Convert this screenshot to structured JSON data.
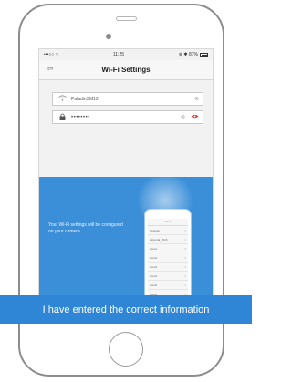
{
  "status_bar": {
    "signal": "•••○○",
    "wifi": "≈",
    "time": "11:25",
    "right": "⊕ ✱ 87%"
  },
  "nav": {
    "back_icon": "⇦",
    "title": "Wi-Fi Settings"
  },
  "form": {
    "ssid_icon": "wifi-icon",
    "ssid_value": "PaladinSM12",
    "ssid_clear": "⊗",
    "password_icon": "lock-icon",
    "password_value": "••••••••",
    "password_clear": "⊗",
    "password_eye": "eye-icon"
  },
  "illustration": {
    "caption": "Your Wi-Fi settings will be configured on your camera.",
    "mini_header": "Wi-Fi",
    "mini_rows": [
      "Network",
      "Airportal_2015",
      "Cam1",
      "Cam2",
      "Cam3",
      "Cam4",
      "Cam5",
      "Cam6"
    ]
  },
  "banner": {
    "label": "I have entered the correct information"
  },
  "colors": {
    "banner": "#2f86d6",
    "panel": "#3b8fd9",
    "eye_accent": "#d0342c"
  }
}
